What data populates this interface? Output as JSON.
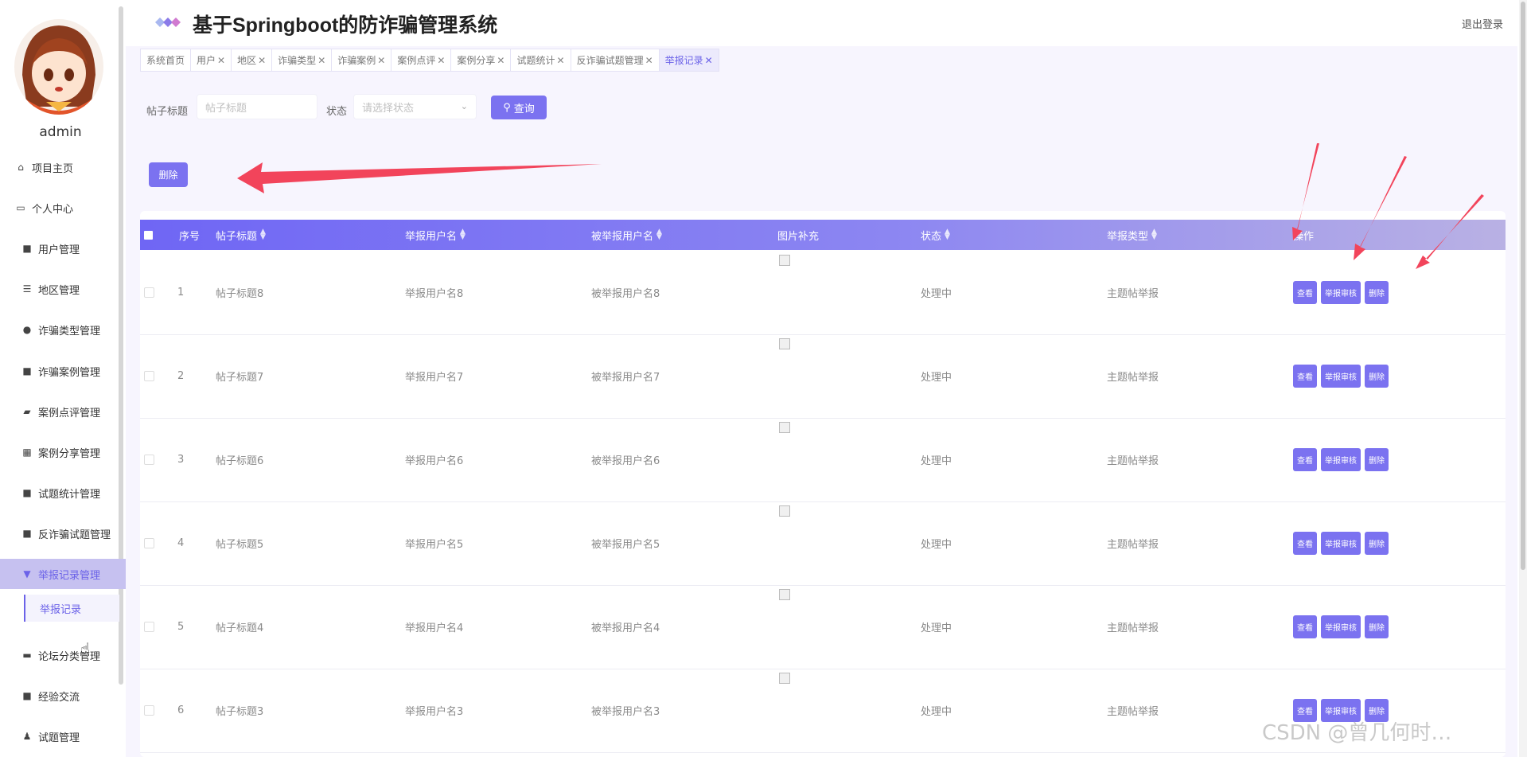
{
  "app": {
    "title": "基于Springboot的防诈骗管理系统",
    "logout": "退出登录"
  },
  "sidebar": {
    "username": "admin",
    "items": [
      {
        "label": "项目主页",
        "icon": "home-icon"
      },
      {
        "label": "个人中心",
        "icon": "profile-icon"
      },
      {
        "label": "用户管理",
        "icon": "grid-icon"
      },
      {
        "label": "地区管理",
        "icon": "list-icon"
      },
      {
        "label": "诈骗类型管理",
        "icon": "pin-icon"
      },
      {
        "label": "诈骗案例管理",
        "icon": "grid-icon"
      },
      {
        "label": "案例点评管理",
        "icon": "ticket-icon"
      },
      {
        "label": "案例分享管理",
        "icon": "apps-icon"
      },
      {
        "label": "试题统计管理",
        "icon": "grid-icon"
      },
      {
        "label": "反诈骗试题管理",
        "icon": "grid-icon"
      },
      {
        "label": "举报记录管理",
        "icon": "flag-icon"
      },
      {
        "label": "论坛分类管理",
        "icon": "book-icon"
      },
      {
        "label": "经验交流",
        "icon": "grid-icon"
      },
      {
        "label": "试题管理",
        "icon": "user-icon"
      }
    ],
    "submenu": {
      "label": "举报记录"
    }
  },
  "tabs": [
    {
      "label": "系统首页",
      "closable": false
    },
    {
      "label": "用户",
      "closable": true
    },
    {
      "label": "地区",
      "closable": true
    },
    {
      "label": "诈骗类型",
      "closable": true
    },
    {
      "label": "诈骗案例",
      "closable": true
    },
    {
      "label": "案例点评",
      "closable": true
    },
    {
      "label": "案例分享",
      "closable": true
    },
    {
      "label": "试题统计",
      "closable": true
    },
    {
      "label": "反诈骗试题管理",
      "closable": true
    },
    {
      "label": "举报记录",
      "closable": true,
      "active": true
    }
  ],
  "search": {
    "title_label": "帖子标题",
    "title_placeholder": "帖子标题",
    "status_label": "状态",
    "status_placeholder": "请选择状态",
    "query_button": "查询"
  },
  "actions": {
    "delete_button": "删除"
  },
  "table": {
    "columns": [
      "序号",
      "帖子标题",
      "举报用户名",
      "被举报用户名",
      "图片补充",
      "状态",
      "举报类型",
      "操作"
    ],
    "row_buttons": [
      "查看",
      "举报审核",
      "删除"
    ],
    "rows": [
      {
        "index": "1",
        "title": "帖子标题8",
        "reporter": "举报用户名8",
        "reported": "被举报用户名8",
        "status": "处理中",
        "type": "主题帖举报"
      },
      {
        "index": "2",
        "title": "帖子标题7",
        "reporter": "举报用户名7",
        "reported": "被举报用户名7",
        "status": "处理中",
        "type": "主题帖举报"
      },
      {
        "index": "3",
        "title": "帖子标题6",
        "reporter": "举报用户名6",
        "reported": "被举报用户名6",
        "status": "处理中",
        "type": "主题帖举报"
      },
      {
        "index": "4",
        "title": "帖子标题5",
        "reporter": "举报用户名5",
        "reported": "被举报用户名5",
        "status": "处理中",
        "type": "主题帖举报"
      },
      {
        "index": "5",
        "title": "帖子标题4",
        "reporter": "举报用户名4",
        "reported": "被举报用户名4",
        "status": "处理中",
        "type": "主题帖举报"
      },
      {
        "index": "6",
        "title": "帖子标题3",
        "reporter": "举报用户名3",
        "reported": "被举报用户名3",
        "status": "处理中",
        "type": "主题帖举报"
      }
    ]
  },
  "watermark": "CSDN @曾几何时…",
  "colors": {
    "accent": "#7b72f0",
    "annotation_arrow": "#f2445b"
  }
}
